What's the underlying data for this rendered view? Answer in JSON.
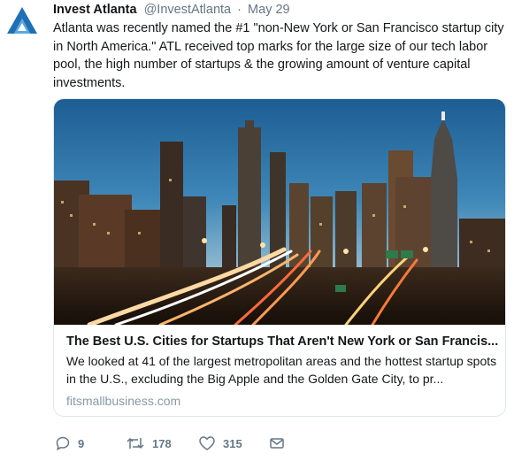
{
  "tweet": {
    "author_name": "Invest Atlanta",
    "author_handle": "@InvestAtlanta",
    "separator": "·",
    "date": "May 29",
    "text": "Atlanta was recently named the #1 \"non-New York or San Francisco startup city in North America.\" ATL received top marks for the large size of our tech labor pool, the high number of startups & the growing amount of venture capital investments."
  },
  "card": {
    "image_description": "Atlanta skyline at dusk with light-trail highway traffic",
    "title": "The Best U.S. Cities for Startups That Aren't New York or San Francis...",
    "description": "We looked at 41 of the largest metropolitan areas and the hottest startup spots in the U.S., excluding the Big Apple and the Golden Gate City, to pr...",
    "domain": "fitsmallbusiness.com"
  },
  "actions": {
    "replies": "9",
    "retweets": "178",
    "likes": "315"
  },
  "colors": {
    "logo_blue": "#1f6fb5",
    "text_primary": "#14171a",
    "text_secondary": "#657786",
    "domain_gray": "#8899a6",
    "border": "#e1e8ed"
  },
  "icons": [
    "invest-atlanta-logo",
    "reply-icon",
    "retweet-icon",
    "like-icon",
    "direct-message-icon"
  ]
}
